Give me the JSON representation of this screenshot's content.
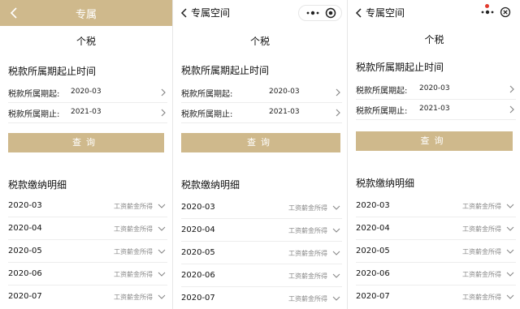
{
  "panels": [
    {
      "nav_title": "专属",
      "subtitle": "个税",
      "section_period": "税款所属期起止时间",
      "start_label": "税款所属期起:",
      "start_value": "2020-03",
      "end_label": "税款所属期止:",
      "end_value": "2021-03",
      "query_button": "查询",
      "section_detail": "税款缴纳明细",
      "records": [
        {
          "month": "2020-03",
          "type": "工资薪金所得"
        },
        {
          "month": "2020-04",
          "type": "工资薪金所得"
        },
        {
          "month": "2020-05",
          "type": "工资薪金所得"
        },
        {
          "month": "2020-06",
          "type": "工资薪金所得"
        },
        {
          "month": "2020-07",
          "type": "工资薪金所得"
        }
      ]
    },
    {
      "nav_title": "专属空间",
      "subtitle": "个税",
      "section_period": "税款所属期起止时间",
      "start_label": "税款所属期起:",
      "start_value": "2020-03",
      "end_label": "税款所属期止:",
      "end_value": "2021-03",
      "query_button": "查询",
      "section_detail": "税款缴纳明细",
      "records": [
        {
          "month": "2020-03",
          "type": "工资薪金所得"
        },
        {
          "month": "2020-04",
          "type": "工资薪金所得"
        },
        {
          "month": "2020-05",
          "type": "工资薪金所得"
        },
        {
          "month": "2020-06",
          "type": "工资薪金所得"
        },
        {
          "month": "2020-07",
          "type": "工资薪金所得"
        }
      ]
    },
    {
      "nav_title": "专属空间",
      "subtitle": "个税",
      "section_period": "税款所属期起止时间",
      "start_label": "税款所属期起:",
      "start_value": "2020-03",
      "end_label": "税款所属期止:",
      "end_value": "2021-03",
      "query_button": "查询",
      "section_detail": "税款缴纳明细",
      "records": [
        {
          "month": "2020-03",
          "type": "工资薪金所得"
        },
        {
          "month": "2020-04",
          "type": "工资薪金所得"
        },
        {
          "month": "2020-05",
          "type": "工资薪金所得"
        },
        {
          "month": "2020-06",
          "type": "工资薪金所得"
        },
        {
          "month": "2020-07",
          "type": "工资薪金所得"
        }
      ]
    }
  ],
  "colors": {
    "accent": "#cfb98c",
    "notification_dot": "#e23b2e"
  },
  "icons": [
    "back-arrow-icon",
    "more-icon",
    "target-icon",
    "close-circle-icon",
    "chevron-right-icon",
    "chevron-down-icon"
  ]
}
